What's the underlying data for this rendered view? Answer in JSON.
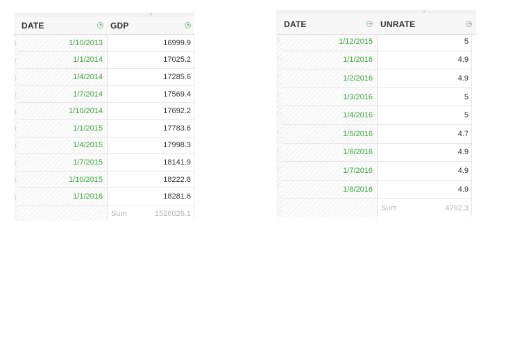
{
  "left_table": {
    "columns": [
      "DATE",
      "GDP"
    ],
    "rows": [
      [
        "1/10/2013",
        "16999.9"
      ],
      [
        "1/1/2014",
        "17025.2"
      ],
      [
        "1/4/2014",
        "17285.6"
      ],
      [
        "1/7/2014",
        "17569.4"
      ],
      [
        "1/10/2014",
        "17692.2"
      ],
      [
        "1/1/2015",
        "17783.6"
      ],
      [
        "1/4/2015",
        "17998.3"
      ],
      [
        "1/7/2015",
        "18141.9"
      ],
      [
        "1/10/2015",
        "18222.8"
      ],
      [
        "1/1/2016",
        "18281.6"
      ]
    ],
    "sum_label": "Sum",
    "sum_value": "1526026.1"
  },
  "right_table": {
    "columns": [
      "DATE",
      "UNRATE"
    ],
    "rows": [
      [
        "1/12/2015",
        "5"
      ],
      [
        "1/1/2016",
        "4.9"
      ],
      [
        "1/2/2016",
        "4.9"
      ],
      [
        "1/3/2016",
        "5"
      ],
      [
        "1/4/2016",
        "5"
      ],
      [
        "1/5/2016",
        "4.7"
      ],
      [
        "1/6/2016",
        "4.9"
      ],
      [
        "1/7/2016",
        "4.9"
      ],
      [
        "1/8/2016",
        "4.9"
      ]
    ],
    "sum_label": "Sum",
    "sum_value": "4792.3"
  },
  "colors": {
    "date_text": "#3aa63a",
    "value_text": "#333333",
    "sum_text": "#b3b3b3"
  },
  "icons": {
    "column_filter": "filter-dropdown-icon"
  }
}
